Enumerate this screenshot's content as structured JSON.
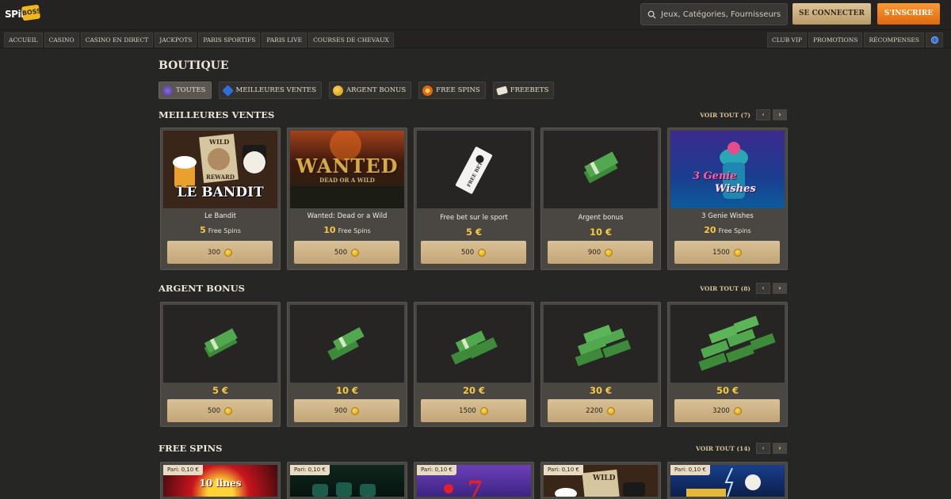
{
  "header": {
    "logo_primary": "SPiN",
    "logo_secondary": "BOSS",
    "search_placeholder": "Jeux, Catégories, Fournisseurs",
    "login_label": "SE CONNECTER",
    "signup_label": "S'INSCRIRE"
  },
  "nav": {
    "left": [
      "ACCUEIL",
      "CASINO",
      "CASINO EN DIRECT",
      "JACKPOTS",
      "PARIS SPORTIFS",
      "PARIS LIVE",
      "COURSES DE CHEVAUX"
    ],
    "right": [
      "CLUB VIP",
      "PROMOTIONS",
      "RÉCOMPENSES"
    ],
    "globe_icon": "globe-icon"
  },
  "page": {
    "title": "BOUTIQUE",
    "filters": [
      {
        "label": "TOUTES",
        "icon": "all-icon",
        "active": true
      },
      {
        "label": "MEILLEURES VENTES",
        "icon": "diamond-icon",
        "active": false
      },
      {
        "label": "ARGENT BONUS",
        "icon": "coins-icon",
        "active": false
      },
      {
        "label": "FREE SPINS",
        "icon": "spin-icon",
        "active": false
      },
      {
        "label": "FREEBETS",
        "icon": "ticket-icon",
        "active": false
      }
    ]
  },
  "sections": [
    {
      "title": "MEILLEURES VENTES",
      "voir_tout": "VOIR TOUT (7)",
      "cards": [
        {
          "name": "Le Bandit",
          "qty": "5",
          "unit": "Free Spins",
          "price": "300",
          "art": "le-bandit"
        },
        {
          "name": "Wanted: Dead or a Wild",
          "qty": "10",
          "unit": "Free Spins",
          "price": "500",
          "art": "wanted"
        },
        {
          "name": "Free bet sur le sport",
          "value": "5 €",
          "price": "500",
          "art": "ticket"
        },
        {
          "name": "Argent bonus",
          "value": "10 €",
          "price": "900",
          "art": "cash"
        },
        {
          "name": "3 Genie Wishes",
          "qty": "20",
          "unit": "Free Spins",
          "price": "1500",
          "art": "genie"
        }
      ]
    },
    {
      "title": "ARGENT BONUS",
      "voir_tout": "VOIR TOUT (8)",
      "cards": [
        {
          "value": "5 €",
          "price": "500"
        },
        {
          "value": "10 €",
          "price": "900"
        },
        {
          "value": "20 €",
          "price": "1500"
        },
        {
          "value": "30 €",
          "price": "2200"
        },
        {
          "value": "50 €",
          "price": "3200"
        }
      ]
    },
    {
      "title": "FREE SPINS",
      "voir_tout": "VOIR TOUT (14)",
      "cards": [
        {
          "bet": "Pari: 0,10 €"
        },
        {
          "bet": "Pari: 0,10 €"
        },
        {
          "bet": "Pari: 0,10 €"
        },
        {
          "bet": "Pari: 0,10 €"
        },
        {
          "bet": "Pari: 0,10 €"
        }
      ]
    }
  ],
  "thumb_text": {
    "bandit_top": "WILD",
    "bandit_reward": "REWARD",
    "bandit_title": "LE BANDIT",
    "wanted_title": "WANTED",
    "wanted_sub": "DEAD OR A WILD",
    "ticket_text": "FREE BET",
    "genie_title": "3 Genie",
    "genie_sub": "Wishes",
    "fs_1_text": "10 lines",
    "fs_4_top": "WILD"
  },
  "colors": {
    "accent_gold": "#f6c844",
    "signup_orange": "#e0680e",
    "login_tan": "#c9ad7e"
  }
}
